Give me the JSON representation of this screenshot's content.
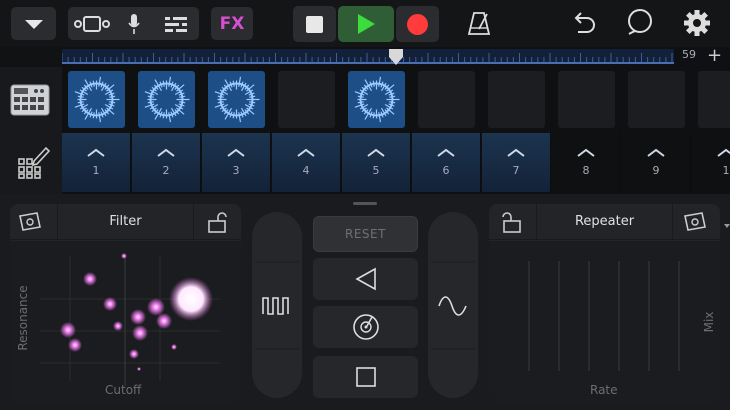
{
  "toolbar": {
    "icons": [
      "chevron-down-icon",
      "tracks-view-icon",
      "microphone-icon",
      "mixer-icon",
      "undo-icon",
      "loop-icon",
      "gear-icon",
      "metronome-icon"
    ],
    "fx_label": "FX",
    "fx_color": "#d64fd0",
    "play_color": "#3ddc3d",
    "record_color": "#ff3b3b"
  },
  "ruler": {
    "bar_number": "59",
    "add_label": "+"
  },
  "track": {
    "cells": [
      true,
      true,
      true,
      false,
      true,
      false,
      false,
      false,
      false,
      false
    ]
  },
  "strip": {
    "pads": [
      {
        "num": "1",
        "active": true
      },
      {
        "num": "2",
        "active": true
      },
      {
        "num": "3",
        "active": true
      },
      {
        "num": "4",
        "active": true
      },
      {
        "num": "5",
        "active": true
      },
      {
        "num": "6",
        "active": true
      },
      {
        "num": "7",
        "active": true
      },
      {
        "num": "8",
        "active": false
      },
      {
        "num": "9",
        "active": false
      },
      {
        "num": "1",
        "active": false
      }
    ]
  },
  "filter": {
    "title": "Filter",
    "x_label": "Cutoff",
    "y_label": "Resonance"
  },
  "center": {
    "reset_label": "RESET"
  },
  "repeater": {
    "title": "Repeater",
    "x_label": "Rate",
    "y_label": "Mix"
  },
  "colors": {
    "accent_blue": "#1d4f86",
    "glow": "#e070e0"
  }
}
